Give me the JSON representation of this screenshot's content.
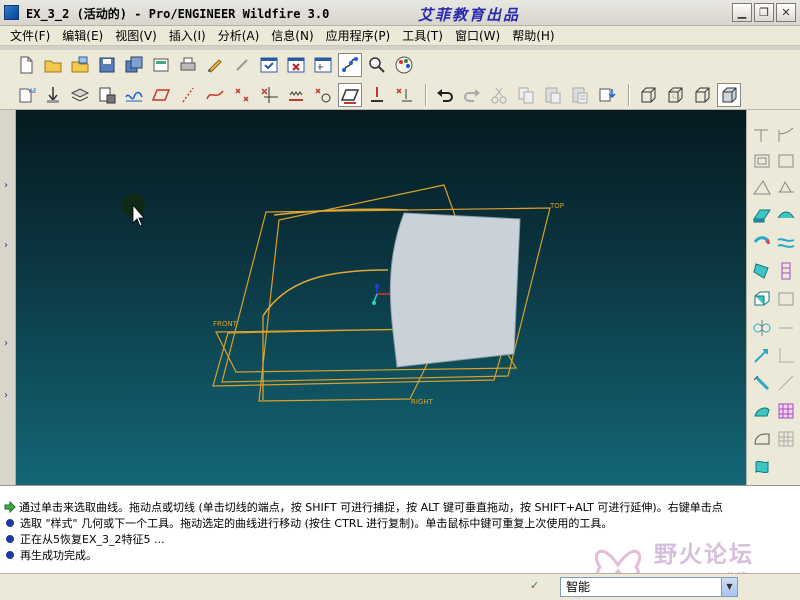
{
  "window": {
    "title": "EX_3_2 (活动的) - Pro/ENGINEER Wildfire 3.0",
    "credit": "艾菲教育出品"
  },
  "menu": {
    "items": [
      {
        "label": "文件(F)"
      },
      {
        "label": "编辑(E)"
      },
      {
        "label": "视图(V)"
      },
      {
        "label": "插入(I)"
      },
      {
        "label": "分析(A)"
      },
      {
        "label": "信息(N)"
      },
      {
        "label": "应用程序(P)"
      },
      {
        "label": "工具(T)"
      },
      {
        "label": "窗口(W)"
      },
      {
        "label": "帮助(H)"
      }
    ]
  },
  "toolbar1": {
    "icons": [
      "new-file-icon",
      "open-folder-icon",
      "open-session-icon",
      "save-icon",
      "save-copy-icon",
      "print-preview-icon",
      "print-icon",
      "email-icon",
      "sketcher-icon",
      "datum-display-icon",
      "close-window-icon",
      "select-box-icon",
      "curve-tool-icon",
      "zoom-icon",
      "palette-icon"
    ]
  },
  "toolbar2": {
    "icons": [
      "datum-plane-icon",
      "datum-axis-icon",
      "layer-icon",
      "view-manager-icon",
      "spline-icon",
      "parallelogram-icon",
      "line-icon",
      "free-curve-icon",
      "point-icon",
      "trim-icon",
      "offset-icon",
      "mirror-icon",
      "planar-icon",
      "project-icon",
      "drop-icon",
      "undo-icon",
      "redo-icon",
      "cut-icon",
      "copy-icon",
      "paste-icon",
      "paste-special-icon",
      "regenerate-icon",
      "wireframe-icon",
      "hidden-line-icon",
      "no-hidden-icon",
      "shaded-icon"
    ]
  },
  "viewport": {
    "labels": {
      "top": "TOP",
      "front": "FRONT",
      "right": "RIGHT"
    },
    "colors": {
      "datum": "#d9a02a",
      "surface": "#c9d2d8",
      "curve": "#e0a93a"
    }
  },
  "messages": [
    {
      "text": "通过单击来选取曲线。拖动点或切线 (单击切线的端点，按 SHIFT 可进行捕捉，按 ALT 键可垂直拖动，按 SHIFT+ALT 可进行延伸)。右键单击点",
      "type": "prompt"
    },
    {
      "text": "选取 \"样式\" 几何或下一个工具。拖动选定的曲线进行移动 (按住 CTRL 进行复制)。单击鼠标中键可重复上次使用的工具。",
      "type": "info"
    },
    {
      "text": "正在从5恢复EX_3_2特征5 ...",
      "type": "info"
    },
    {
      "text": "再生成功完成。",
      "type": "info"
    }
  ],
  "watermark": {
    "text": "野火论坛",
    "url": "www.proewildfire.cn"
  },
  "status": {
    "filter_value": "智能"
  }
}
